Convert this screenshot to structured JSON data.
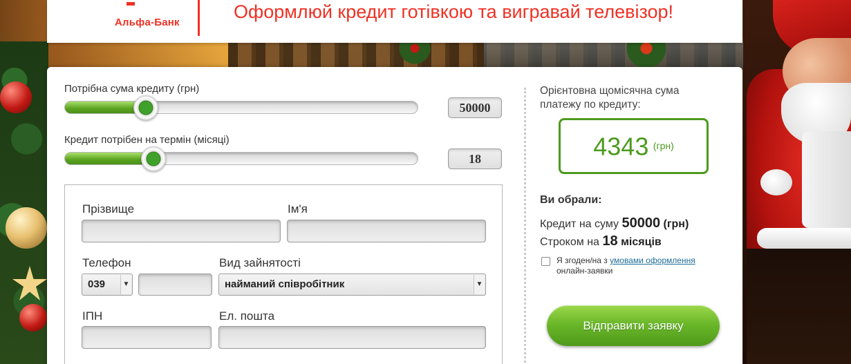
{
  "brand": {
    "logo_text": "Альфа-Банк",
    "accent_color": "#ef3124",
    "green_color": "#4c9a1e"
  },
  "header": {
    "title": "Оформлюй кредит готівкою та вигравай телевізор!"
  },
  "calculator": {
    "amount": {
      "label": "Потрібна сума кредиту (грн)",
      "value": "50000",
      "fill_fraction": 0.23
    },
    "term": {
      "label": "Кредит потрібен на термін (місяці)",
      "value": "18",
      "fill_fraction": 0.25
    }
  },
  "form": {
    "surname_label": "Прізвище",
    "name_label": "Ім'я",
    "phone_label": "Телефон",
    "phone_code": "039",
    "employment_label": "Вид зайнятості",
    "employment_value": "найманий співробітник",
    "ipn_label": "ІПН",
    "email_label": "Ел. пошта"
  },
  "summary": {
    "payment_label": "Орієнтовна щомісячна сума платежу по кредиту:",
    "payment_value": "4343",
    "payment_unit": "(грн)",
    "chosen_heading": "Ви обрали:",
    "credit_prefix": "Кредит на суму",
    "credit_amount": "50000",
    "credit_unit": "(грн)",
    "term_prefix": "Строком на",
    "term_value": "18",
    "term_unit": "місяців"
  },
  "consent": {
    "prefix": "Я згоден/на з",
    "link": "умовами оформлення",
    "suffix": "онлайн-заявки"
  },
  "submit": {
    "label": "Відправити заявку"
  },
  "icons": {
    "select_arrow": "chevron-down-icon"
  }
}
